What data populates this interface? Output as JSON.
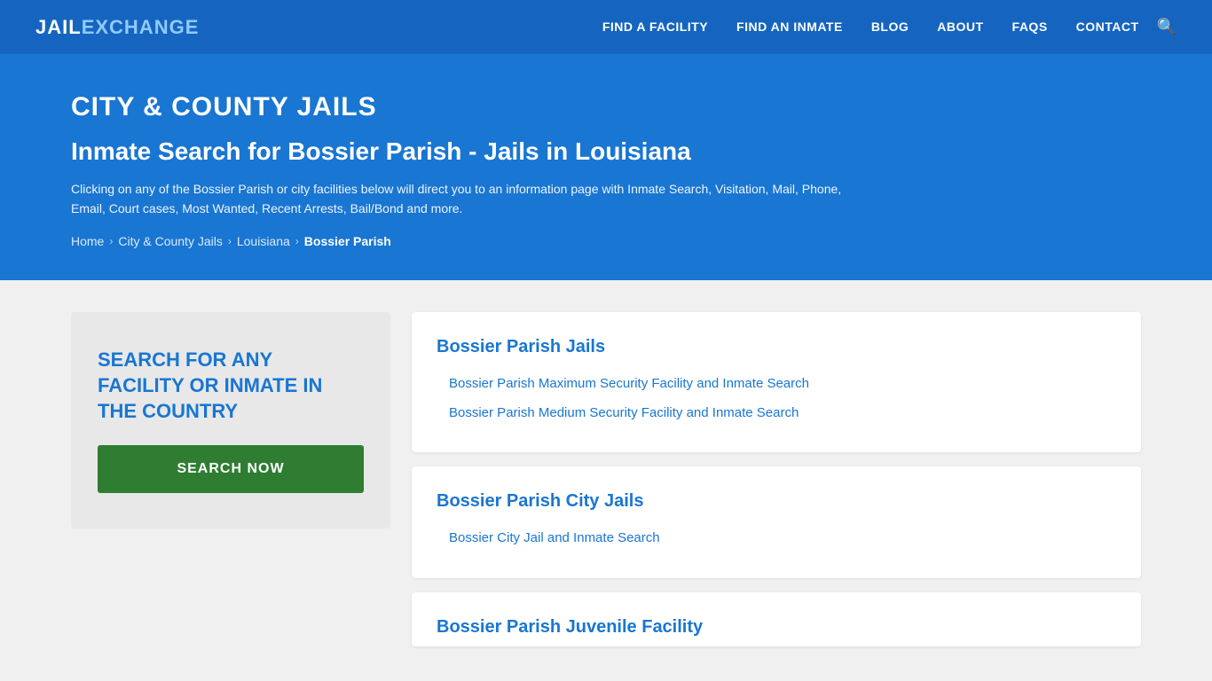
{
  "logo": {
    "part1": "JAIL",
    "part2": "EXCHANGE"
  },
  "nav": {
    "links": [
      {
        "id": "find-facility",
        "label": "FIND A FACILITY"
      },
      {
        "id": "find-inmate",
        "label": "FIND AN INMATE"
      },
      {
        "id": "blog",
        "label": "BLOG"
      },
      {
        "id": "about",
        "label": "ABOUT"
      },
      {
        "id": "faqs",
        "label": "FAQs"
      },
      {
        "id": "contact",
        "label": "CONTACT"
      }
    ]
  },
  "hero": {
    "category": "CITY & COUNTY JAILS",
    "title": "Inmate Search for Bossier Parish - Jails in Louisiana",
    "description": "Clicking on any of the Bossier Parish or city facilities below will direct you to an information page with Inmate Search, Visitation, Mail, Phone, Email, Court cases, Most Wanted, Recent Arrests, Bail/Bond and more.",
    "breadcrumb": {
      "items": [
        {
          "label": "Home",
          "current": false
        },
        {
          "label": "City & County Jails",
          "current": false
        },
        {
          "label": "Louisiana",
          "current": false
        },
        {
          "label": "Bossier Parish",
          "current": true
        }
      ]
    }
  },
  "sidebar": {
    "search_title": "SEARCH FOR ANY FACILITY OR INMATE IN THE COUNTRY",
    "search_button": "SEARCH NOW"
  },
  "cards": [
    {
      "id": "bossier-parish-jails",
      "title": "Bossier Parish Jails",
      "links": [
        "Bossier Parish Maximum Security Facility and Inmate Search",
        "Bossier Parish Medium Security Facility and Inmate Search"
      ]
    },
    {
      "id": "bossier-parish-city-jails",
      "title": "Bossier Parish City Jails",
      "links": [
        "Bossier City Jail and Inmate Search"
      ]
    },
    {
      "id": "bossier-parish-juvenile",
      "title": "Bossier Parish Juvenile Facility",
      "links": []
    }
  ]
}
